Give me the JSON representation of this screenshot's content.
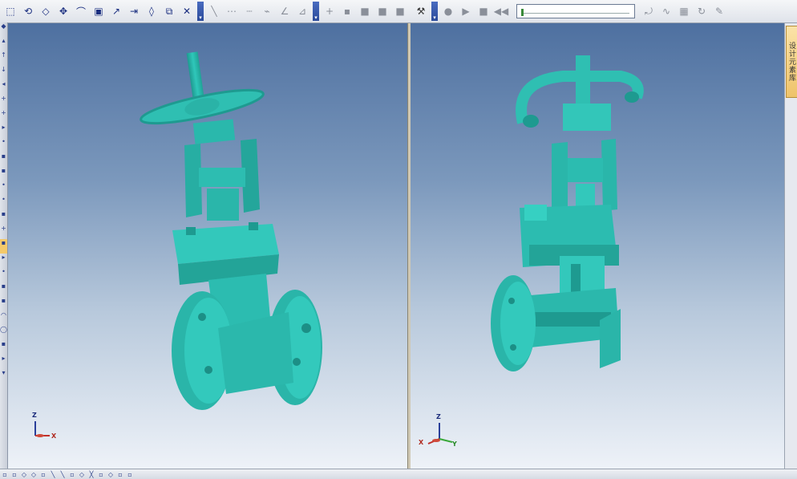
{
  "toolbar": {
    "group1": [
      "select-box-icon",
      "rotate-icon",
      "surface-icon",
      "pan-icon",
      "arc-icon",
      "cube-icon",
      "move-icon",
      "extrude-icon",
      "shape-icon",
      "mirror-icon",
      "delete-icon"
    ],
    "group2": [
      "line-icon",
      "polyline-icon",
      "dash-line-icon",
      "angle-icon",
      "angle-icon-2"
    ],
    "group3": [
      "add-icon",
      "view-icon",
      "block-icon",
      "block-icon-2",
      "block-icon-3"
    ],
    "group4": [
      "tool-icon"
    ],
    "group5": [
      "record-icon",
      "play-icon",
      "stop-icon",
      "rewind-icon"
    ],
    "group6": [
      "rotate-view-icon",
      "curve-icon",
      "table-icon",
      "refresh-icon",
      "settings-icon"
    ]
  },
  "slider": {
    "value": 0
  },
  "side_tab": {
    "label": "设计元素库"
  },
  "left_view": {
    "triad": {
      "z": "Z",
      "x": "X"
    }
  },
  "right_view": {
    "triad": {
      "z": "Z",
      "x": "X",
      "y": "Y"
    }
  },
  "colors": {
    "model": "#2fbfb2",
    "model_dark": "#1e9a90",
    "model_light": "#5fe0d4"
  }
}
